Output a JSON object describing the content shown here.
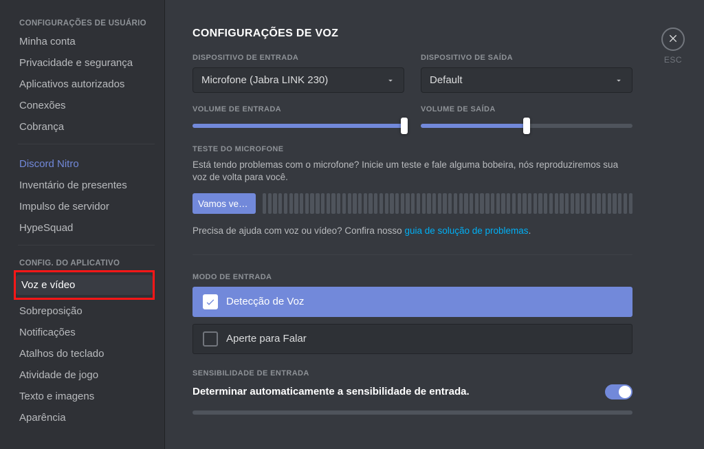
{
  "sidebar": {
    "section1_header": "Configurações de usuário",
    "items1": [
      "Minha conta",
      "Privacidade e segurança",
      "Aplicativos autorizados",
      "Conexões",
      "Cobrança"
    ],
    "nitro": "Discord Nitro",
    "items2": [
      "Inventário de presentes",
      "Impulso de servidor",
      "HypeSquad"
    ],
    "section3_header": "Config. do aplicativo",
    "items3": [
      "Voz e vídeo",
      "Sobreposição",
      "Notificações",
      "Atalhos do teclado",
      "Atividade de jogo",
      "Texto e imagens",
      "Aparência"
    ]
  },
  "close_label": "ESC",
  "title": "CONFIGURAÇÕES DE VOZ",
  "input_device": {
    "label": "Dispositivo de entrada",
    "value": "Microfone (Jabra LINK 230)"
  },
  "output_device": {
    "label": "Dispositivo de saída",
    "value": "Default"
  },
  "input_volume": {
    "label": "Volume de entrada",
    "pct": 100
  },
  "output_volume": {
    "label": "Volume de saída",
    "pct": 50
  },
  "mic_test": {
    "label": "Teste do microfone",
    "desc": "Está tendo problemas com o microfone? Inicie um teste e fale alguma bobeira, nós reproduziremos sua voz de volta para você.",
    "button": "Vamos verif…"
  },
  "help": {
    "pre": "Precisa de ajuda com voz ou vídeo? Confira nosso ",
    "link": "guia de solução de problemas",
    "post": "."
  },
  "input_mode": {
    "label": "Modo de entrada",
    "options": [
      "Detecção de Voz",
      "Aperte para Falar"
    ]
  },
  "sensitivity": {
    "label": "Sensibilidade de entrada",
    "toggle_title": "Determinar automaticamente a sensibilidade de entrada.",
    "toggle_on": true
  }
}
